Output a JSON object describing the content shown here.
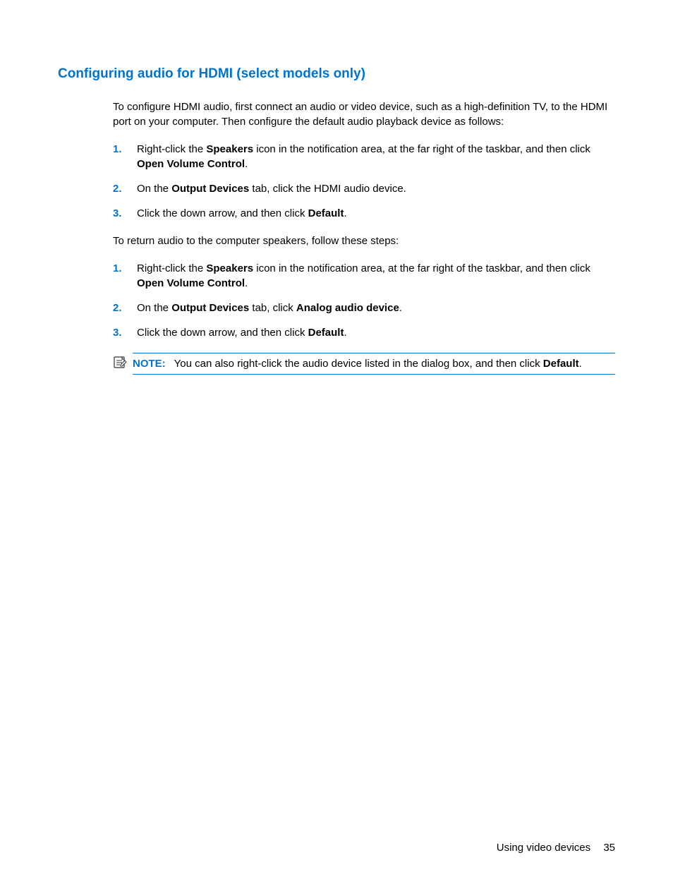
{
  "heading": "Configuring audio for HDMI (select models only)",
  "intro1": "To configure HDMI audio, first connect an audio or video device, such as a high-definition TV, to the HDMI port on your computer. Then configure the default audio playback device as follows:",
  "list1": [
    {
      "num": "1.",
      "parts": [
        {
          "t": "Right-click the "
        },
        {
          "t": "Speakers",
          "b": true
        },
        {
          "t": " icon in the notification area, at the far right of the taskbar, and then click "
        },
        {
          "t": "Open Volume Control",
          "b": true
        },
        {
          "t": "."
        }
      ]
    },
    {
      "num": "2.",
      "parts": [
        {
          "t": "On the "
        },
        {
          "t": "Output Devices",
          "b": true
        },
        {
          "t": " tab, click the HDMI audio device."
        }
      ]
    },
    {
      "num": "3.",
      "parts": [
        {
          "t": "Click the down arrow, and then click "
        },
        {
          "t": "Default",
          "b": true
        },
        {
          "t": "."
        }
      ]
    }
  ],
  "intro2": "To return audio to the computer speakers, follow these steps:",
  "list2": [
    {
      "num": "1.",
      "parts": [
        {
          "t": "Right-click the "
        },
        {
          "t": "Speakers",
          "b": true
        },
        {
          "t": " icon in the notification area, at the far right of the taskbar, and then click "
        },
        {
          "t": "Open Volume Control",
          "b": true
        },
        {
          "t": "."
        }
      ]
    },
    {
      "num": "2.",
      "parts": [
        {
          "t": "On the "
        },
        {
          "t": "Output Devices",
          "b": true
        },
        {
          "t": " tab, click "
        },
        {
          "t": "Analog audio device",
          "b": true
        },
        {
          "t": "."
        }
      ]
    },
    {
      "num": "3.",
      "parts": [
        {
          "t": "Click the down arrow, and then click "
        },
        {
          "t": "Default",
          "b": true
        },
        {
          "t": "."
        }
      ]
    }
  ],
  "note": {
    "label": "NOTE:",
    "parts": [
      {
        "t": "You can also right-click the audio device listed in the dialog box, and then click "
      },
      {
        "t": "Default",
        "b": true
      },
      {
        "t": "."
      }
    ]
  },
  "footer": {
    "section": "Using video devices",
    "page": "35"
  }
}
